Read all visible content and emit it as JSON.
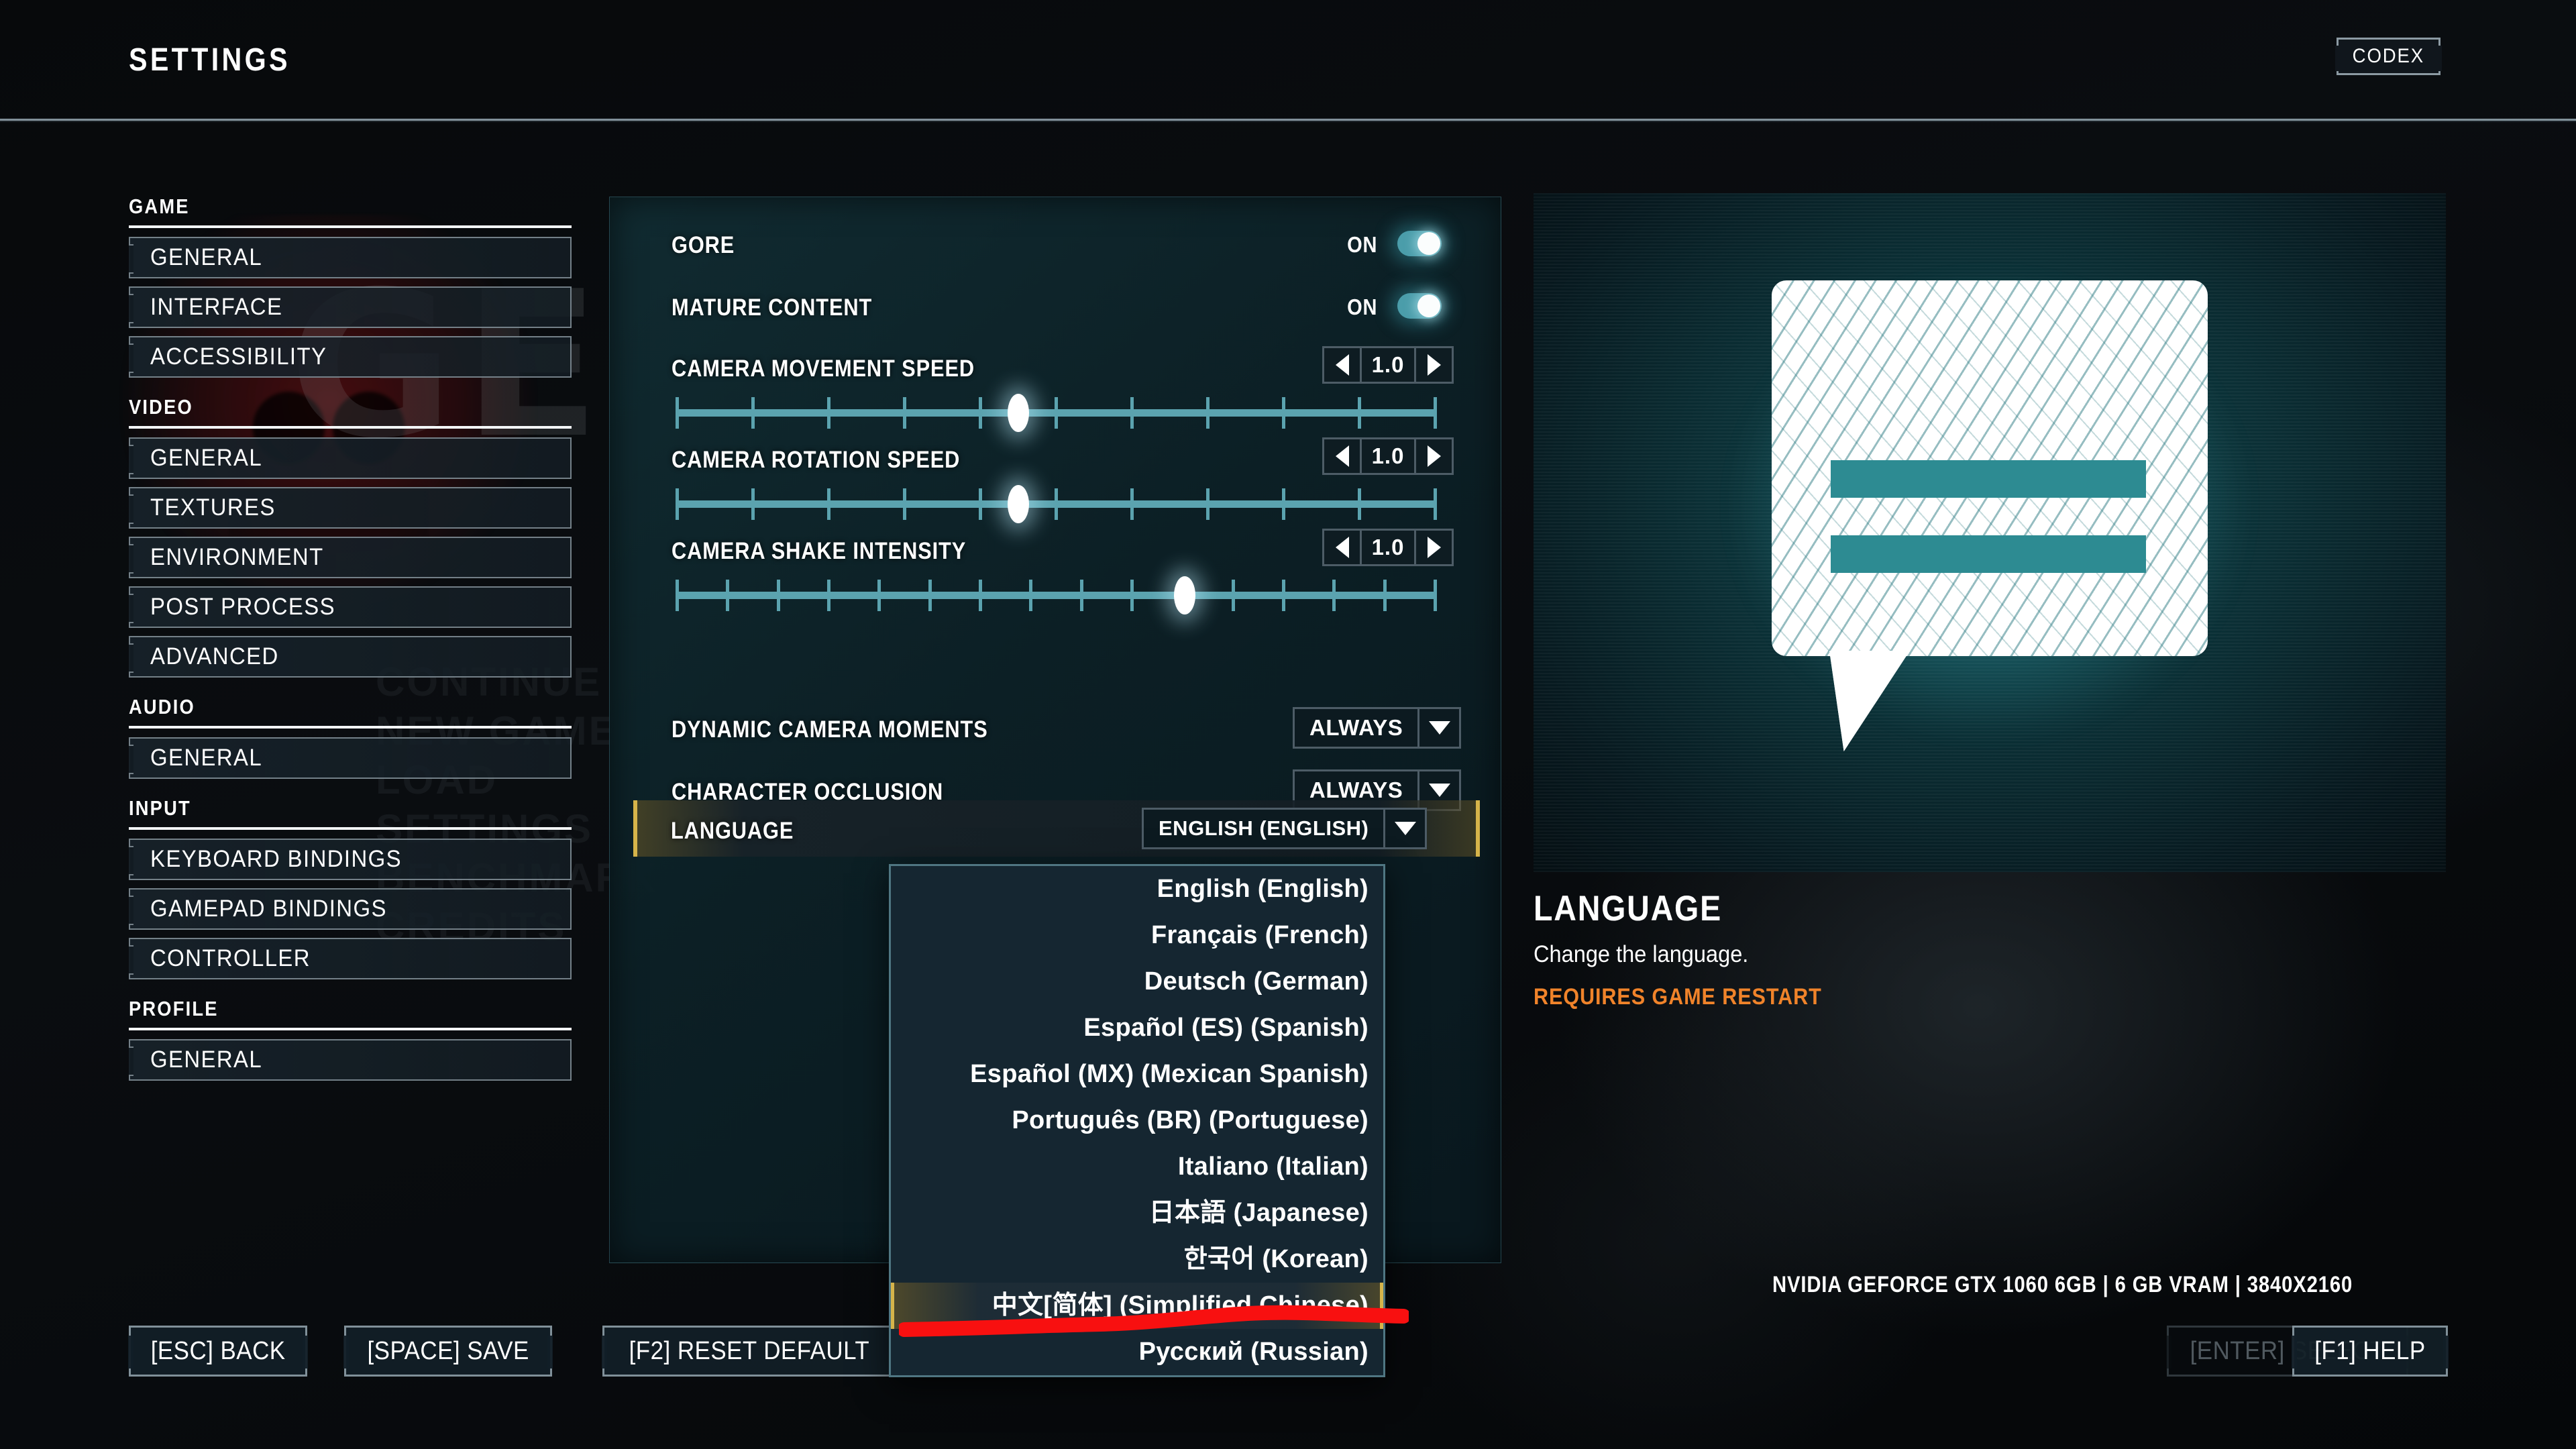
{
  "header": {
    "title": "SETTINGS",
    "codex_label": "CODEX"
  },
  "background": {
    "logo_letters": "GE",
    "ghost_menu": "CONTINUE\nNEW GAME\nLOAD\nSETTINGS\nBENCHMARK\nCREDITS"
  },
  "sidebar": {
    "groups": [
      {
        "title": "GAME",
        "items": [
          {
            "label": "GENERAL"
          },
          {
            "label": "INTERFACE"
          },
          {
            "label": "ACCESSIBILITY"
          }
        ]
      },
      {
        "title": "VIDEO",
        "items": [
          {
            "label": "GENERAL"
          },
          {
            "label": "TEXTURES"
          },
          {
            "label": "ENVIRONMENT"
          },
          {
            "label": "POST PROCESS"
          },
          {
            "label": "ADVANCED"
          }
        ]
      },
      {
        "title": "AUDIO",
        "items": [
          {
            "label": "GENERAL"
          }
        ]
      },
      {
        "title": "INPUT",
        "items": [
          {
            "label": "KEYBOARD BINDINGS"
          },
          {
            "label": "GAMEPAD BINDINGS"
          },
          {
            "label": "CONTROLLER"
          }
        ]
      },
      {
        "title": "PROFILE",
        "items": [
          {
            "label": "GENERAL"
          }
        ]
      }
    ]
  },
  "settings": {
    "gore": {
      "label": "GORE",
      "state": "ON"
    },
    "mature_content": {
      "label": "MATURE CONTENT",
      "state": "ON"
    },
    "camera_move": {
      "label": "CAMERA MOVEMENT SPEED",
      "value": "1.0",
      "ticks": 10,
      "knob_pct": 45
    },
    "camera_rotate": {
      "label": "CAMERA ROTATION SPEED",
      "value": "1.0",
      "ticks": 10,
      "knob_pct": 45
    },
    "camera_shake": {
      "label": "CAMERA SHAKE INTENSITY",
      "value": "1.0",
      "ticks": 15,
      "knob_pct": 67
    },
    "dynamic_camera": {
      "label": "DYNAMIC CAMERA MOMENTS",
      "value": "ALWAYS"
    },
    "character_occlusion": {
      "label": "CHARACTER OCCLUSION",
      "value": "ALWAYS"
    },
    "language": {
      "label": "LANGUAGE",
      "value": "ENGLISH (ENGLISH)"
    }
  },
  "language_dropdown": {
    "options": [
      {
        "label": "English (English)",
        "selected": false
      },
      {
        "label": "Français (French)",
        "selected": false
      },
      {
        "label": "Deutsch (German)",
        "selected": false
      },
      {
        "label": "Español (ES) (Spanish)",
        "selected": false
      },
      {
        "label": "Español (MX) (Mexican Spanish)",
        "selected": false
      },
      {
        "label": "Português (BR) (Portuguese)",
        "selected": false
      },
      {
        "label": "Italiano (Italian)",
        "selected": false
      },
      {
        "label": "日本語 (Japanese)",
        "selected": false
      },
      {
        "label": "한국어 (Korean)",
        "selected": false
      },
      {
        "label": "中文[简体] (Simplified Chinese)",
        "selected": true
      },
      {
        "label": "Русский (Russian)",
        "selected": false
      }
    ]
  },
  "info_panel": {
    "title": "LANGUAGE",
    "description": "Change the language.",
    "warning": "REQUIRES GAME RESTART",
    "icon": "speech-bubble-icon"
  },
  "gpu_info": "NVIDIA GEFORCE GTX 1060 6GB | 6 GB VRAM | 3840X2160",
  "footer": {
    "back": "[ESC] BACK",
    "save": "[SPACE] SAVE",
    "reset": "[F2] RESET DEFAULT",
    "enter": "[ENTER] SELECT",
    "help": "[F1] HELP"
  },
  "colors": {
    "accent_teal": "#5ba3af",
    "toggle_on": "#4b9daa",
    "warning_orange": "#f0832a",
    "highlight_gold": "#d6b44a",
    "annotation_red": "#f81010",
    "panel_bg": "#0c2026"
  }
}
